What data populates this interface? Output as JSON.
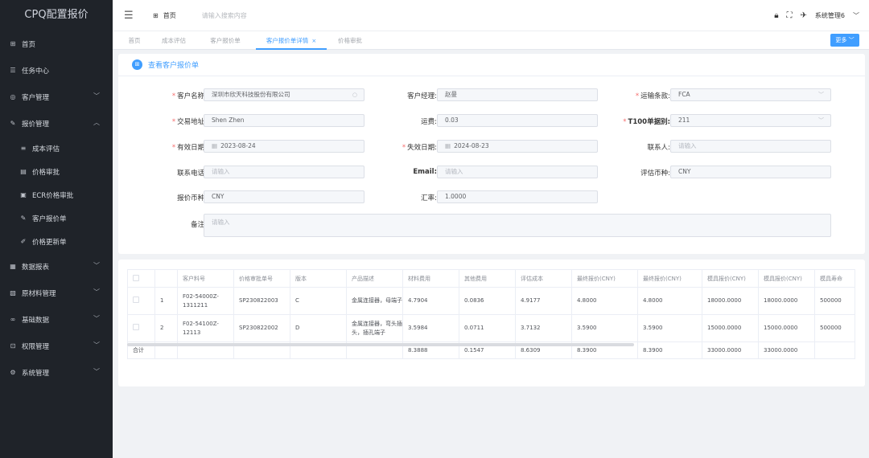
{
  "app_title": "CPQ配置报价",
  "sidebar": {
    "items": [
      {
        "icon": "grid-icon",
        "glyph": "⊞",
        "label": "首页",
        "expand": ""
      },
      {
        "icon": "task-icon",
        "glyph": "☰",
        "label": "任务中心",
        "expand": ""
      },
      {
        "icon": "customer-icon",
        "glyph": "◎",
        "label": "客户管理",
        "expand": "﹀"
      },
      {
        "icon": "quote-icon",
        "glyph": "✎",
        "label": "报价管理",
        "expand": "︿"
      }
    ],
    "sub_items": [
      {
        "icon": "list-icon",
        "glyph": "≡",
        "label": "成本评估"
      },
      {
        "icon": "doc-icon",
        "glyph": "▤",
        "label": "价格审批"
      },
      {
        "icon": "ecr-icon",
        "glyph": "▣",
        "label": "ECR价格审批"
      },
      {
        "icon": "customer-quote-icon",
        "glyph": "✎",
        "label": "客户报价单"
      },
      {
        "icon": "price-update-icon",
        "glyph": "✐",
        "label": "价格更新单"
      }
    ],
    "bottom_items": [
      {
        "icon": "report-icon",
        "glyph": "▦",
        "label": "数据报表",
        "expand": "﹀"
      },
      {
        "icon": "material-icon",
        "glyph": "▧",
        "label": "原材料管理",
        "expand": "﹀"
      },
      {
        "icon": "basedata-icon",
        "glyph": "∞",
        "label": "基础数据",
        "expand": "﹀"
      },
      {
        "icon": "lock-icon",
        "glyph": "⊡",
        "label": "权限管理",
        "expand": "﹀"
      },
      {
        "icon": "gear-icon",
        "glyph": "⚙",
        "label": "系统管理",
        "expand": "﹀"
      }
    ]
  },
  "header": {
    "breadcrumb": "首页",
    "search_placeholder": "请输入搜索内容",
    "user": "系统管理6"
  },
  "tabs": [
    "首页",
    "成本评估",
    "客户报价单",
    "客户报价单详情",
    "价格审批"
  ],
  "more_label": "更多",
  "form": {
    "title": "查看客户报价单",
    "customer_name_label": "客户名称:",
    "customer_name": "深圳市欣天科技股份有限公司",
    "manager_label": "客户经理:",
    "manager": "赵曼",
    "transport_label": "运输条款:",
    "transport": "FCA",
    "address_label": "交易地址:",
    "address": "Shen Zhen",
    "freight_label": "运费:",
    "freight": "0.03",
    "t100_label": "T100单据别:",
    "t100": "211",
    "eff_date_label": "有效日期:",
    "eff_date": "2023-08-24",
    "exp_date_label": "失效日期:",
    "exp_date": "2024-08-23",
    "contact_label": "联系人:",
    "phone_label": "联系电话:",
    "email_label": "Email:",
    "eval_currency_label": "评估币种:",
    "eval_currency": "CNY",
    "quote_currency_label": "报价币种:",
    "quote_currency": "CNY",
    "rate_label": "汇率:",
    "rate": "1.0000",
    "remark_label": "备注:",
    "placeholder": "请输入",
    "required_mark": "*"
  },
  "table": {
    "headers": [
      "",
      "",
      "客户料号",
      "价格审批单号",
      "版本",
      "产品描述",
      "材料费用",
      "其他费用",
      "评估成本",
      "最终报价(CNY)",
      "最终报价(CNY)",
      "模具报价(CNY)",
      "模具报价(CNY)",
      "模具寿命"
    ],
    "rows": [
      [
        "1",
        "F02-54000Z-1311211",
        "SP230822003",
        "C",
        "金属连接器，母端子",
        "4.7904",
        "0.0836",
        "4.9177",
        "4.8000",
        "4.8000",
        "18000.0000",
        "18000.0000",
        "500000"
      ],
      [
        "2",
        "F02-54100Z-12113",
        "SP230822002",
        "D",
        "金属连接器，弯头插头，插孔端子",
        "3.5984",
        "0.0711",
        "3.7132",
        "3.5900",
        "3.5900",
        "15000.0000",
        "15000.0000",
        "500000"
      ]
    ],
    "summary": [
      "合计",
      "",
      "",
      "",
      "",
      "",
      "8.3888",
      "0.1547",
      "8.6309",
      "8.3900",
      "8.3900",
      "33000.0000",
      "33000.0000",
      ""
    ]
  }
}
